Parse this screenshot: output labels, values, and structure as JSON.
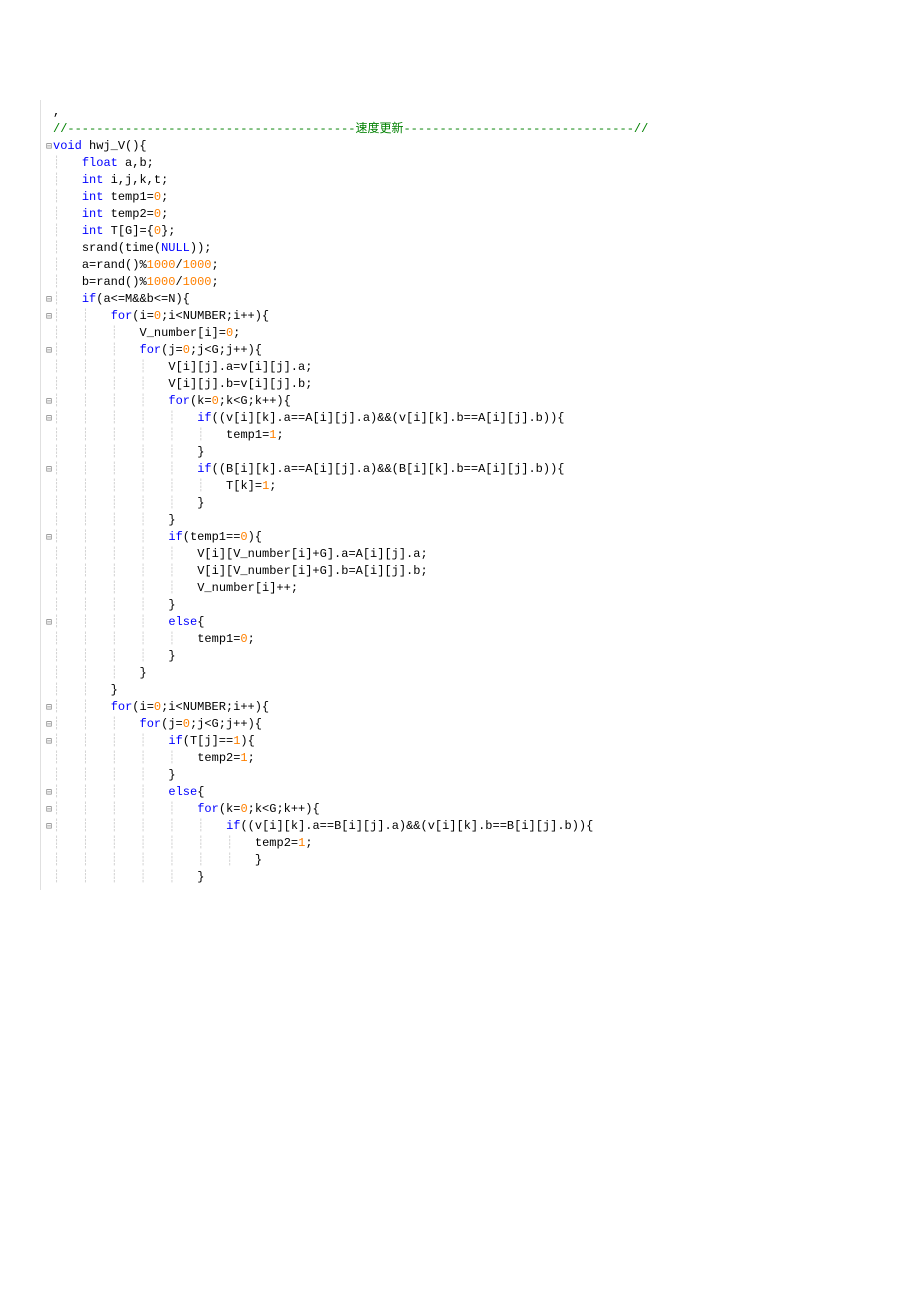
{
  "code": {
    "lines": [
      {
        "indent": 0,
        "html": ","
      },
      {
        "indent": 0,
        "html": "<span class='comment-green'>//----------------------------------------</span><span class='cn'>速度更新</span><span class='comment-green'>--------------------------------//</span>"
      },
      {
        "indent": 0,
        "fold": "⊟",
        "html": "<span class='kw'>void</span> hwj_V(){"
      },
      {
        "indent": 1,
        "html": "<span class='kw'>float</span> a,b;"
      },
      {
        "indent": 1,
        "html": "<span class='kw'>int</span> i,j,k,t;"
      },
      {
        "indent": 1,
        "html": "<span class='kw'>int</span> temp1=<span class='num'>0</span>;"
      },
      {
        "indent": 1,
        "html": "<span class='kw'>int</span> temp2=<span class='num'>0</span>;"
      },
      {
        "indent": 1,
        "html": "<span class='kw'>int</span> T[G]={<span class='num'>0</span>};"
      },
      {
        "indent": 1,
        "html": "srand(time(<span class='kw'>NULL</span>));"
      },
      {
        "indent": 1,
        "html": "a=rand()%<span class='num'>1000</span>/<span class='num'>1000</span>;"
      },
      {
        "indent": 1,
        "html": "b=rand()%<span class='num'>1000</span>/<span class='num'>1000</span>;"
      },
      {
        "indent": 1,
        "fold": "⊟",
        "html": "<span class='kw'>if</span>(a&lt;=M&amp;&amp;b&lt;=N){"
      },
      {
        "indent": 2,
        "fold": "⊟",
        "html": "<span class='kw'>for</span>(i=<span class='num'>0</span>;i&lt;NUMBER;i++){"
      },
      {
        "indent": 3,
        "html": "V_number[i]=<span class='num'>0</span>;"
      },
      {
        "indent": 3,
        "fold": "⊟",
        "html": "<span class='kw'>for</span>(j=<span class='num'>0</span>;j&lt;G;j++){"
      },
      {
        "indent": 4,
        "html": "V[i][j].a=v[i][j].a;"
      },
      {
        "indent": 4,
        "html": "V[i][j].b=v[i][j].b;"
      },
      {
        "indent": 4,
        "fold": "⊟",
        "html": "<span class='kw'>for</span>(k=<span class='num'>0</span>;k&lt;G;k++){"
      },
      {
        "indent": 5,
        "fold": "⊟",
        "html": "<span class='kw'>if</span>((v[i][k].a==A[i][j].a)&amp;&amp;(v[i][k].b==A[i][j].b)){"
      },
      {
        "indent": 6,
        "html": "temp1=<span class='num'>1</span>;"
      },
      {
        "indent": 5,
        "html": "}"
      },
      {
        "indent": 5,
        "fold": "⊟",
        "html": "<span class='kw'>if</span>((B[i][k].a==A[i][j].a)&amp;&amp;(B[i][k].b==A[i][j].b)){"
      },
      {
        "indent": 6,
        "html": "T[k]=<span class='num'>1</span>;"
      },
      {
        "indent": 5,
        "html": "}"
      },
      {
        "indent": 4,
        "html": "}"
      },
      {
        "indent": 4,
        "fold": "⊟",
        "html": "<span class='kw'>if</span>(temp1==<span class='num'>0</span>){"
      },
      {
        "indent": 5,
        "html": "V[i][V_number[i]+G].a=A[i][j].a;"
      },
      {
        "indent": 5,
        "html": "V[i][V_number[i]+G].b=A[i][j].b;"
      },
      {
        "indent": 5,
        "html": "V_number[i]++;"
      },
      {
        "indent": 4,
        "html": "}"
      },
      {
        "indent": 4,
        "fold": "⊟",
        "html": "<span class='kw'>else</span>{"
      },
      {
        "indent": 5,
        "html": "temp1=<span class='num'>0</span>;"
      },
      {
        "indent": 4,
        "html": "}"
      },
      {
        "indent": 3,
        "html": "}"
      },
      {
        "indent": 2,
        "html": "}"
      },
      {
        "indent": 2,
        "fold": "⊟",
        "html": "<span class='kw'>for</span>(i=<span class='num'>0</span>;i&lt;NUMBER;i++){"
      },
      {
        "indent": 3,
        "fold": "⊟",
        "html": "<span class='kw'>for</span>(j=<span class='num'>0</span>;j&lt;G;j++){"
      },
      {
        "indent": 4,
        "fold": "⊟",
        "html": "<span class='kw'>if</span>(T[j]==<span class='num'>1</span>){"
      },
      {
        "indent": 5,
        "html": "temp2=<span class='num'>1</span>;"
      },
      {
        "indent": 4,
        "html": "}"
      },
      {
        "indent": 4,
        "fold": "⊟",
        "html": "<span class='kw'>else</span>{"
      },
      {
        "indent": 5,
        "fold": "⊟",
        "html": "<span class='kw'>for</span>(k=<span class='num'>0</span>;k&lt;G;k++){"
      },
      {
        "indent": 6,
        "fold": "⊟",
        "html": "<span class='kw'>if</span>((v[i][k].a==B[i][j].a)&amp;&amp;(v[i][k].b==B[i][j].b)){"
      },
      {
        "indent": 7,
        "html": "temp2=<span class='num'>1</span>;"
      },
      {
        "indent": 7,
        "html": "}"
      },
      {
        "indent": 5,
        "html": "}"
      }
    ]
  }
}
